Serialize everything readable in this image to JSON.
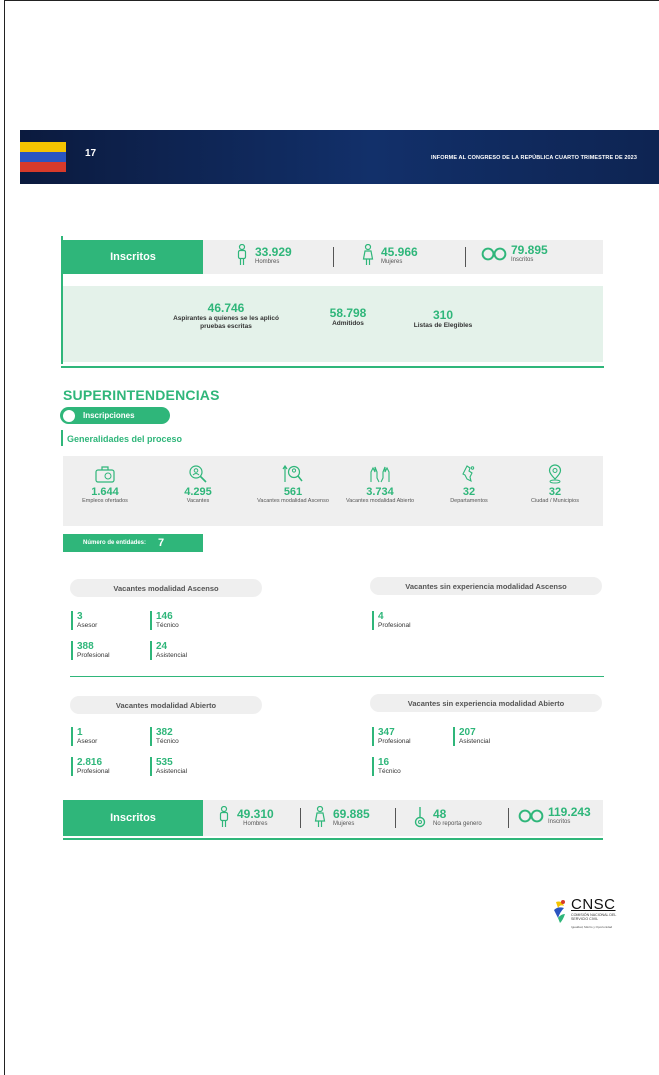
{
  "header": {
    "page_number": "17",
    "report_title": "INFORME AL CONGRESO DE LA REPÚBLICA CUARTO TRIMESTRE DE 2023"
  },
  "top_inscritos": {
    "label": "Inscritos",
    "hombres": {
      "value": "33.929",
      "label": "Hombres"
    },
    "mujeres": {
      "value": "45.966",
      "label": "Mujeres"
    },
    "total": {
      "value": "79.895",
      "label": "Inscritos"
    }
  },
  "summary": {
    "aspirantes": {
      "value": "46.746",
      "label": "Aspirantes a quienes se les aplicó pruebas escritas"
    },
    "admitidos": {
      "value": "58.798",
      "label": "Admitidos"
    },
    "listas": {
      "value": "310",
      "label": "Listas de Elegibles"
    }
  },
  "section": {
    "title": "SUPERINTENDENCIAS",
    "pill": "Inscripciones",
    "subhead": "Generalidades del proceso"
  },
  "generalidades": [
    {
      "value": "1.644",
      "label": "Empleos ofertados",
      "icon": "briefcase-icon"
    },
    {
      "value": "4.295",
      "label": "Vacantes",
      "icon": "search-person-icon"
    },
    {
      "value": "561",
      "label": "Vacantes modalidad Ascenso",
      "icon": "ascend-search-icon"
    },
    {
      "value": "3.734",
      "label": "Vacantes modalidad Abierto",
      "icon": "open-hands-icon"
    },
    {
      "value": "32",
      "label": "Departamentos",
      "icon": "map-region-icon"
    },
    {
      "value": "32",
      "label": "Ciudad / Municipios",
      "icon": "location-pin-icon"
    }
  ],
  "entities": {
    "label": "Número de entidades:",
    "value": "7"
  },
  "ascenso": {
    "title": "Vacantes modalidad Ascenso",
    "items": [
      {
        "value": "3",
        "label": "Asesor"
      },
      {
        "value": "146",
        "label": "Técnico"
      },
      {
        "value": "388",
        "label": "Profesional"
      },
      {
        "value": "24",
        "label": "Asistencial"
      }
    ]
  },
  "sin_exp_ascenso": {
    "title": "Vacantes sin experiencia modalidad Ascenso",
    "items": [
      {
        "value": "4",
        "label": "Profesional"
      }
    ]
  },
  "abierto": {
    "title": "Vacantes modalidad Abierto",
    "items": [
      {
        "value": "1",
        "label": "Asesor"
      },
      {
        "value": "382",
        "label": "Técnico"
      },
      {
        "value": "2.816",
        "label": "Profesional"
      },
      {
        "value": "535",
        "label": "Asistencial"
      }
    ]
  },
  "sin_exp_abierto": {
    "title": "Vacantes sin experiencia modalidad Abierto",
    "items": [
      {
        "value": "347",
        "label": "Profesional"
      },
      {
        "value": "207",
        "label": "Asistencial"
      },
      {
        "value": "16",
        "label": "Técnico"
      }
    ]
  },
  "bottom_inscritos": {
    "label": "Inscritos",
    "hombres": {
      "value": "49.310",
      "label": "Hombres"
    },
    "mujeres": {
      "value": "69.885",
      "label": "Mujeres"
    },
    "no_reporta": {
      "value": "48",
      "label": "No reporta genero"
    },
    "total": {
      "value": "119.243",
      "label": "Inscritos"
    }
  },
  "logo": {
    "name": "CNSC",
    "subtitle": "COMISIÓN NACIONAL DEL SERVICIO CIVIL",
    "tagline": "Igualdad, Mérito y Oportunidad"
  },
  "colors": {
    "accent": "#2fb67a",
    "header": "#0b1a3e",
    "panel": "#efefef"
  }
}
